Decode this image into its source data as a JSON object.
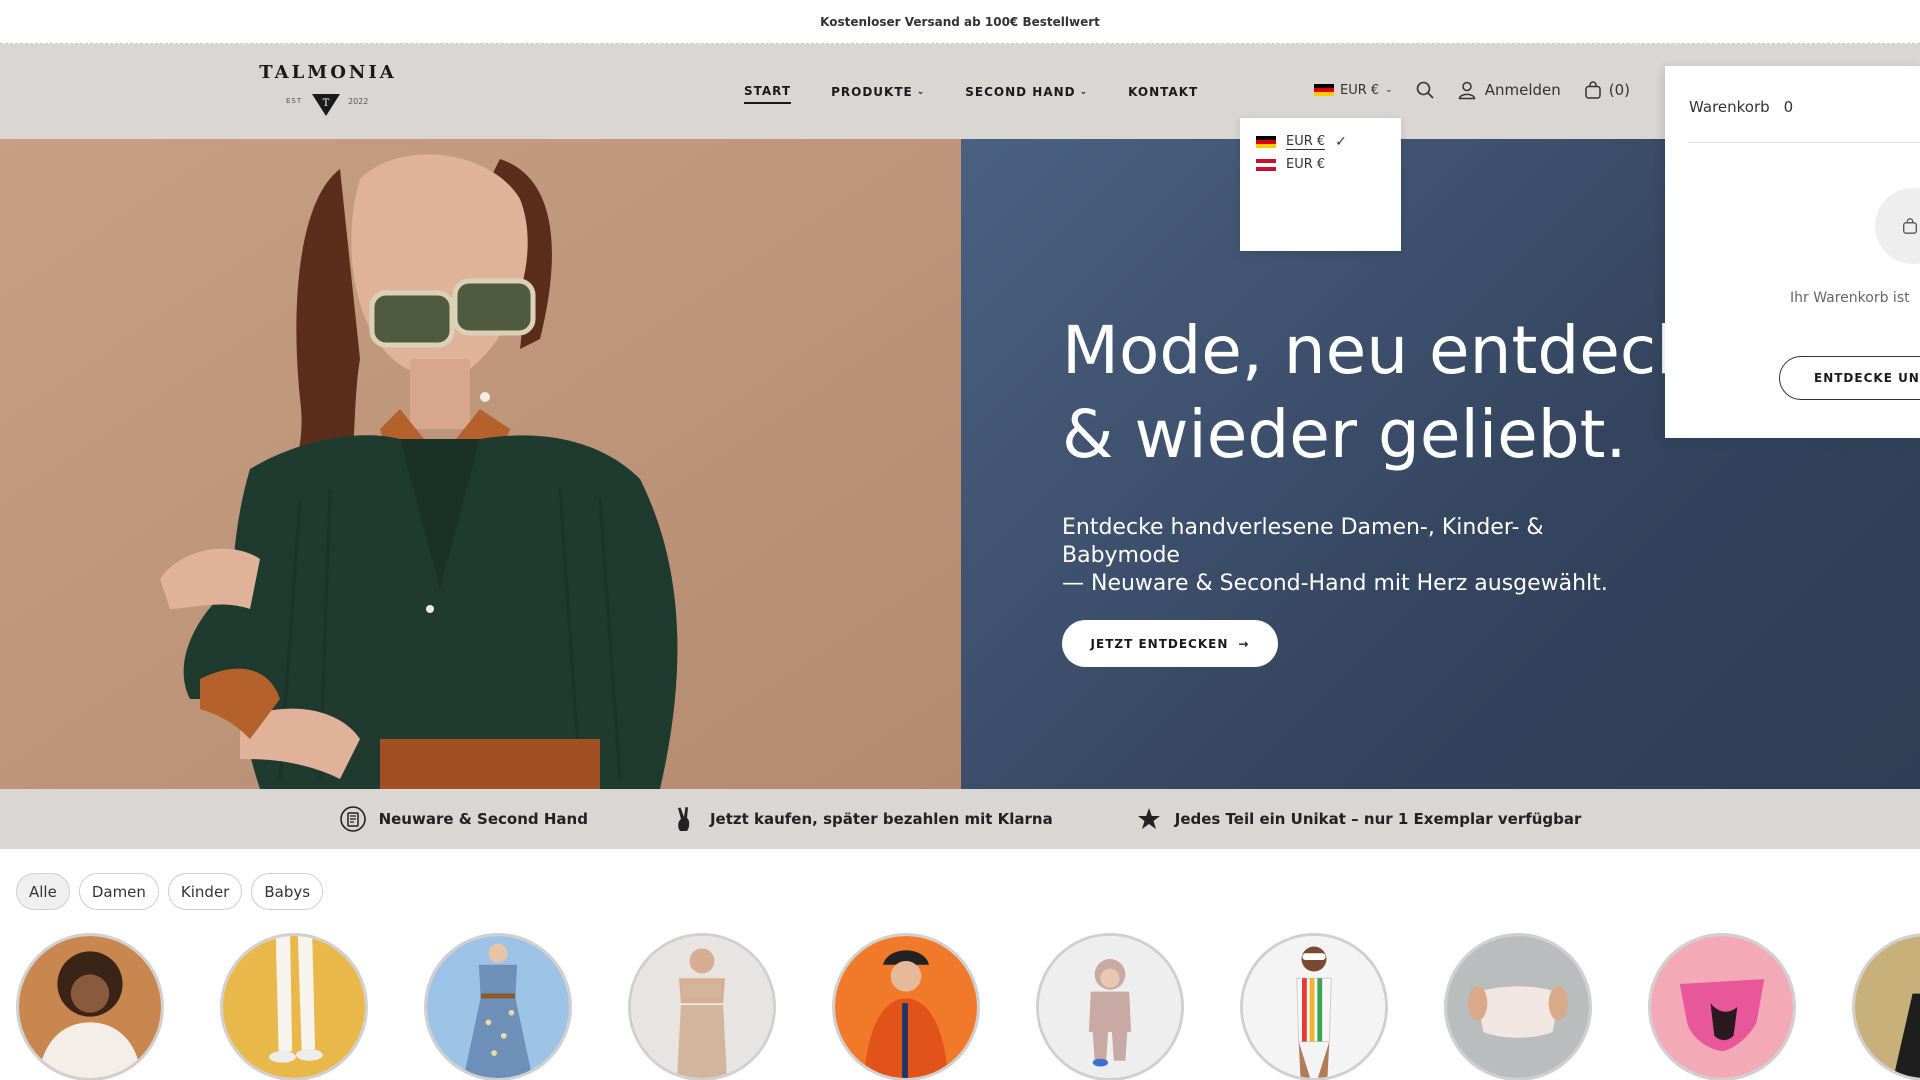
{
  "announcement": "Kostenloser Versand ab 100€ Bestellwert",
  "logo": {
    "name": "TALMONIA",
    "est": "EST",
    "year": "2022",
    "badge_letter": "T"
  },
  "nav": [
    {
      "label": "START",
      "active": true,
      "has_dropdown": false
    },
    {
      "label": "PRODUKTE",
      "active": false,
      "has_dropdown": true
    },
    {
      "label": "SECOND HAND",
      "active": false,
      "has_dropdown": true
    },
    {
      "label": "KONTAKT",
      "active": false,
      "has_dropdown": false
    }
  ],
  "header": {
    "currency": "EUR €",
    "login_label": "Anmelden",
    "cart_count": "(0)"
  },
  "currency_dropdown": {
    "options": [
      {
        "flag": "de",
        "label": "EUR €",
        "selected": true
      },
      {
        "flag": "at",
        "label": "EUR €",
        "selected": false
      }
    ]
  },
  "hero": {
    "title_line1": "Mode, neu entdeckt",
    "title_line2": "& wieder geliebt.",
    "subtitle_line1": "Entdecke handverlesene Damen-, Kinder- & Babymode",
    "subtitle_line2": "— Neuware & Second-Hand mit Herz ausgewählt.",
    "cta_label": "JETZT ENTDECKEN",
    "cta_arrow": "→"
  },
  "cart_drawer": {
    "title": "Warenkorb",
    "count": "0",
    "empty_text": "Ihr Warenkorb ist",
    "button_label": "ENTDECKE UNSE"
  },
  "features": [
    {
      "icon": "second-hand-icon",
      "label": "Neuware & Second Hand"
    },
    {
      "icon": "peace-hand-icon",
      "label": "Jetzt kaufen, später bezahlen mit Klarna"
    },
    {
      "icon": "star-icon",
      "label": "Jedes Teil ein Unikat – nur 1 Exemplar verfügbar"
    }
  ],
  "filters": [
    {
      "label": "Alle",
      "active": true
    },
    {
      "label": "Damen",
      "active": false
    },
    {
      "label": "Kinder",
      "active": false
    },
    {
      "label": "Babys",
      "active": false
    }
  ],
  "categories": [
    {
      "name": "woman-sweater",
      "bg": "#c9874f"
    },
    {
      "name": "white-jeans",
      "bg": "#e9b84a"
    },
    {
      "name": "floral-dress",
      "bg": "#9cc3e6"
    },
    {
      "name": "shapewear",
      "bg": "#e8e4e2"
    },
    {
      "name": "kids-jacket",
      "bg": "#f07a2a"
    },
    {
      "name": "baby-outfit",
      "bg": "#eeeeee"
    },
    {
      "name": "swimsuit",
      "bg": "#f4f4f4"
    },
    {
      "name": "underwear",
      "bg": "#b9bdbd"
    },
    {
      "name": "period-pants",
      "bg": "#f3a9b6"
    },
    {
      "name": "more",
      "bg": "#c8b07a"
    }
  ],
  "colors": {
    "header_bg": "#d9d6d4",
    "hero_left_bg": "#c39a7e",
    "hero_right_bg": "#3d4f6c"
  }
}
